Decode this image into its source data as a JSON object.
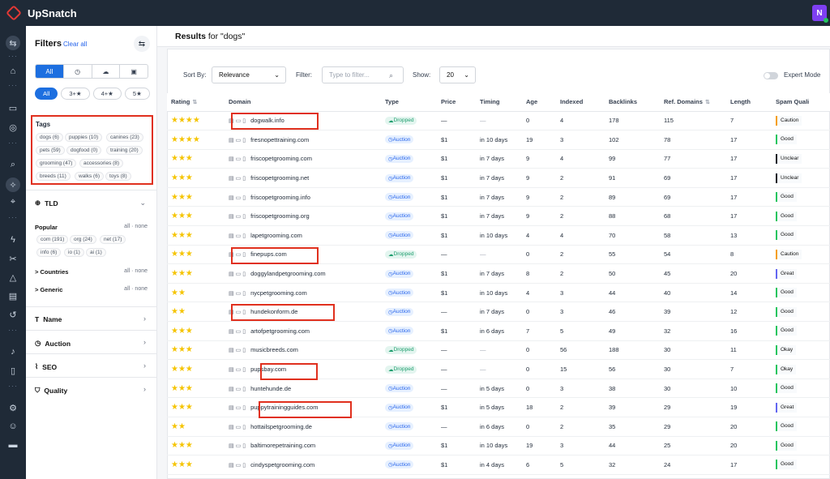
{
  "app": {
    "brand": "UpSnatch",
    "avatar_letter": "N"
  },
  "filters": {
    "title": "Filters",
    "clear_all": "Clear all",
    "type_tabs": [
      "All",
      "",
      "",
      ""
    ],
    "rating_pills": [
      "All",
      "3+★",
      "4+★",
      "5★"
    ],
    "tags": {
      "title": "Tags",
      "items": [
        "dogs (6)",
        "puppies (10)",
        "canines (23)",
        "pets (59)",
        "dogfood (0)",
        "training (20)",
        "grooming (47)",
        "accessories (8)",
        "breeds (11)",
        "walks (6)",
        "toys (8)"
      ]
    },
    "tld": {
      "title": "TLD",
      "popular_label": "Popular",
      "all": "all",
      "none": "none",
      "items": [
        "com (191)",
        "org (24)",
        "net (17)",
        "info (6)",
        "io (1)",
        "ai (1)"
      ],
      "countries_label": "> Countries",
      "generic_label": "> Generic"
    },
    "sections": [
      "Name",
      "Auction",
      "SEO",
      "Quality"
    ]
  },
  "results": {
    "title_prefix": "Results",
    "title_suffix": " for \"dogs\"",
    "sort_label": "Sort By:",
    "sort_value": "Relevance",
    "filter_label": "Filter:",
    "filter_placeholder": "Type to filter...",
    "show_label": "Show:",
    "show_value": "20",
    "expert_mode": "Expert Mode",
    "columns": [
      "Rating",
      "Domain",
      "Type",
      "Price",
      "Timing",
      "Age",
      "Indexed",
      "Backlinks",
      "Ref. Domains",
      "Length",
      "Spam Quali"
    ],
    "rows": [
      {
        "stars": "★★★★",
        "domain": "dogwalk.info",
        "type": "Dropped",
        "price": "—",
        "timing": "—",
        "age": "0",
        "indexed": "4",
        "backlinks": "178",
        "ref": "115",
        "length": "7",
        "spam": "Caution",
        "spam_color": "#f59e0b"
      },
      {
        "stars": "★★★★",
        "domain": "fresnopettraining.com",
        "type": "Auction",
        "price": "$1",
        "timing": "in 10 days",
        "age": "19",
        "indexed": "3",
        "backlinks": "102",
        "ref": "78",
        "length": "17",
        "spam": "Good",
        "spam_color": "#22c55e"
      },
      {
        "stars": "★★★",
        "domain": "friscopetgrooming.com",
        "type": "Auction",
        "price": "$1",
        "timing": "in 7 days",
        "age": "9",
        "indexed": "4",
        "backlinks": "99",
        "ref": "77",
        "length": "17",
        "spam": "Unclear",
        "spam_color": "#111827"
      },
      {
        "stars": "★★★",
        "domain": "friscopetgrooming.net",
        "type": "Auction",
        "price": "$1",
        "timing": "in 7 days",
        "age": "9",
        "indexed": "2",
        "backlinks": "91",
        "ref": "69",
        "length": "17",
        "spam": "Unclear",
        "spam_color": "#111827"
      },
      {
        "stars": "★★★",
        "domain": "friscopetgrooming.info",
        "type": "Auction",
        "price": "$1",
        "timing": "in 7 days",
        "age": "9",
        "indexed": "2",
        "backlinks": "89",
        "ref": "69",
        "length": "17",
        "spam": "Good",
        "spam_color": "#22c55e"
      },
      {
        "stars": "★★★",
        "domain": "friscopetgrooming.org",
        "type": "Auction",
        "price": "$1",
        "timing": "in 7 days",
        "age": "9",
        "indexed": "2",
        "backlinks": "88",
        "ref": "68",
        "length": "17",
        "spam": "Good",
        "spam_color": "#22c55e"
      },
      {
        "stars": "★★★",
        "domain": "lapetgrooming.com",
        "type": "Auction",
        "price": "$1",
        "timing": "in 10 days",
        "age": "4",
        "indexed": "4",
        "backlinks": "70",
        "ref": "58",
        "length": "13",
        "spam": "Good",
        "spam_color": "#22c55e"
      },
      {
        "stars": "★★★",
        "domain": "finepups.com",
        "type": "Dropped",
        "price": "—",
        "timing": "—",
        "age": "0",
        "indexed": "2",
        "backlinks": "55",
        "ref": "54",
        "length": "8",
        "spam": "Caution",
        "spam_color": "#f59e0b"
      },
      {
        "stars": "★★★",
        "domain": "doggylandpetgrooming.com",
        "type": "Auction",
        "price": "$1",
        "timing": "in 7 days",
        "age": "8",
        "indexed": "2",
        "backlinks": "50",
        "ref": "45",
        "length": "20",
        "spam": "Great",
        "spam_color": "#6366f1"
      },
      {
        "stars": "★★",
        "domain": "nycpetgrooming.com",
        "type": "Auction",
        "price": "$1",
        "timing": "in 10 days",
        "age": "4",
        "indexed": "3",
        "backlinks": "44",
        "ref": "40",
        "length": "14",
        "spam": "Good",
        "spam_color": "#22c55e"
      },
      {
        "stars": "★★",
        "domain": "hundekonform.de",
        "type": "Auction",
        "price": "—",
        "timing": "in 7 days",
        "age": "0",
        "indexed": "3",
        "backlinks": "46",
        "ref": "39",
        "length": "12",
        "spam": "Good",
        "spam_color": "#22c55e"
      },
      {
        "stars": "★★★",
        "domain": "artofpetgrooming.com",
        "type": "Auction",
        "price": "$1",
        "timing": "in 6 days",
        "age": "7",
        "indexed": "5",
        "backlinks": "49",
        "ref": "32",
        "length": "16",
        "spam": "Good",
        "spam_color": "#22c55e"
      },
      {
        "stars": "★★★",
        "domain": "musicbreeds.com",
        "type": "Dropped",
        "price": "—",
        "timing": "—",
        "age": "0",
        "indexed": "56",
        "backlinks": "188",
        "ref": "30",
        "length": "11",
        "spam": "Okay",
        "spam_color": "#22c55e"
      },
      {
        "stars": "★★★",
        "domain": "pupsbay.com",
        "type": "Dropped",
        "price": "—",
        "timing": "—",
        "age": "0",
        "indexed": "15",
        "backlinks": "56",
        "ref": "30",
        "length": "7",
        "spam": "Okay",
        "spam_color": "#22c55e"
      },
      {
        "stars": "★★★",
        "domain": "huntehunde.de",
        "type": "Auction",
        "price": "—",
        "timing": "in 5 days",
        "age": "0",
        "indexed": "3",
        "backlinks": "38",
        "ref": "30",
        "length": "10",
        "spam": "Good",
        "spam_color": "#22c55e"
      },
      {
        "stars": "★★★",
        "domain": "puppytrainingguides.com",
        "type": "Auction",
        "price": "$1",
        "timing": "in 5 days",
        "age": "18",
        "indexed": "2",
        "backlinks": "39",
        "ref": "29",
        "length": "19",
        "spam": "Great",
        "spam_color": "#6366f1"
      },
      {
        "stars": "★★",
        "domain": "hottailspetgrooming.de",
        "type": "Auction",
        "price": "—",
        "timing": "in 6 days",
        "age": "0",
        "indexed": "2",
        "backlinks": "35",
        "ref": "29",
        "length": "20",
        "spam": "Good",
        "spam_color": "#22c55e"
      },
      {
        "stars": "★★★",
        "domain": "baltimorepetraining.com",
        "type": "Auction",
        "price": "$1",
        "timing": "in 10 days",
        "age": "19",
        "indexed": "3",
        "backlinks": "44",
        "ref": "25",
        "length": "20",
        "spam": "Good",
        "spam_color": "#22c55e"
      },
      {
        "stars": "★★★",
        "domain": "cindyspetgrooming.com",
        "type": "Auction",
        "price": "$1",
        "timing": "in 4 days",
        "age": "6",
        "indexed": "5",
        "backlinks": "32",
        "ref": "24",
        "length": "17",
        "spam": "Good",
        "spam_color": "#22c55e"
      }
    ]
  }
}
